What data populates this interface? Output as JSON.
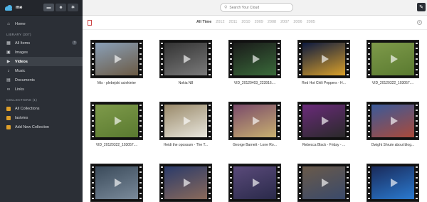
{
  "sidebar": {
    "username": "me",
    "header_buttons": [
      {
        "icon": "inbox-icon",
        "glyph": "▬"
      },
      {
        "icon": "people-icon",
        "glyph": "☻"
      },
      {
        "icon": "gear-icon",
        "glyph": "✱"
      }
    ],
    "home_label": "Home",
    "library_title": "LIBRARY (307)",
    "library_items": [
      {
        "label": "All Items",
        "icon": "grid-icon",
        "glyph": "▦",
        "count": "3"
      },
      {
        "label": "Images",
        "icon": "image-icon",
        "glyph": "▣"
      },
      {
        "label": "Videos",
        "icon": "video-icon",
        "glyph": "▶",
        "active": true
      },
      {
        "label": "Music",
        "icon": "music-icon",
        "glyph": "♪"
      },
      {
        "label": "Documents",
        "icon": "document-icon",
        "glyph": "▤"
      },
      {
        "label": "Links",
        "icon": "link-icon",
        "glyph": "∞"
      }
    ],
    "collections_title": "COLLECTIONS (1)",
    "collections": [
      {
        "label": "All Collections"
      },
      {
        "label": "lastvies"
      },
      {
        "label": "Add New Collection"
      }
    ]
  },
  "topbar": {
    "search_placeholder": "Search Your Cloud"
  },
  "filter": {
    "years": [
      "All Time",
      "2012",
      "2011",
      "2010",
      "2009",
      "2008",
      "2007",
      "2006",
      "2005"
    ],
    "selected": "All Time"
  },
  "videos": [
    {
      "title": "Mis - plebejski uciekinier",
      "colors": [
        "#8aa0b8",
        "#6b5a44"
      ]
    },
    {
      "title": "Nokia N8",
      "colors": [
        "#333",
        "#7a7a7a"
      ]
    },
    {
      "title": "VID_20120403_223916....",
      "colors": [
        "#1a1a1a",
        "#3a6a3a"
      ]
    },
    {
      "title": "Red Hot Chili Peppers - H...",
      "colors": [
        "#0d1a40",
        "#d9a02a"
      ]
    },
    {
      "title": "VID_20120322_103057....",
      "colors": [
        "#7e9a4a",
        "#5a7a30"
      ]
    },
    {
      "title": "VID_20120322_103057....",
      "colors": [
        "#7e9a4a",
        "#5a7a30"
      ]
    },
    {
      "title": "Heidi the opossum - The T...",
      "colors": [
        "#9a8a6a",
        "#e8e6dd"
      ]
    },
    {
      "title": "George Barnett - Lone Ro...",
      "colors": [
        "#7a4a6a",
        "#c8b070"
      ]
    },
    {
      "title": "Rebecca Black - Friday - ...",
      "colors": [
        "#6a2a7a",
        "#2a2a2a"
      ]
    },
    {
      "title": "Dwight Shrute about blog...",
      "colors": [
        "#3a5a9a",
        "#aa4a3a"
      ]
    },
    {
      "title": "",
      "colors": [
        "#3a4a5a",
        "#7a8a9a"
      ]
    },
    {
      "title": "",
      "colors": [
        "#2a3a6a",
        "#8a6a5a"
      ]
    },
    {
      "title": "",
      "colors": [
        "#5a4a7a",
        "#2a2a4a"
      ]
    },
    {
      "title": "",
      "colors": [
        "#6a5a4a",
        "#3a4a6a"
      ]
    },
    {
      "title": "",
      "colors": [
        "#1a2a5a",
        "#2a7ad0"
      ]
    }
  ],
  "colors": {
    "sidebar_bg": "#2b2f36",
    "accent": "#4fb3e6",
    "collection": "#e0a02a"
  }
}
